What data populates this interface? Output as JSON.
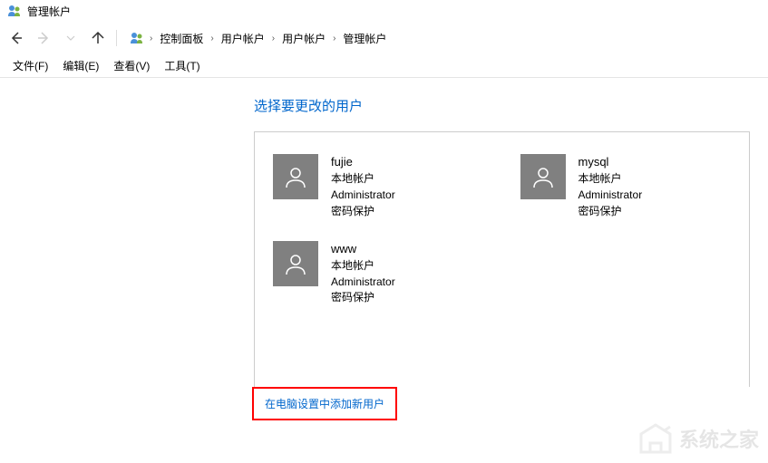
{
  "title_bar": {
    "title": "管理帐户"
  },
  "breadcrumb": {
    "items": [
      {
        "label": "控制面板"
      },
      {
        "label": "用户帐户"
      },
      {
        "label": "用户帐户"
      },
      {
        "label": "管理帐户"
      }
    ]
  },
  "menu": {
    "file": "文件(F)",
    "edit": "编辑(E)",
    "view": "查看(V)",
    "tools": "工具(T)"
  },
  "page": {
    "heading": "选择要更改的用户",
    "add_user_link": "在电脑设置中添加新用户"
  },
  "accounts": [
    {
      "name": "fujie",
      "type": "本地帐户",
      "role": "Administrator",
      "protection": "密码保护"
    },
    {
      "name": "mysql",
      "type": "本地帐户",
      "role": "Administrator",
      "protection": "密码保护"
    },
    {
      "name": "www",
      "type": "本地帐户",
      "role": "Administrator",
      "protection": "密码保护"
    }
  ],
  "watermark": {
    "text": "系统之家"
  }
}
